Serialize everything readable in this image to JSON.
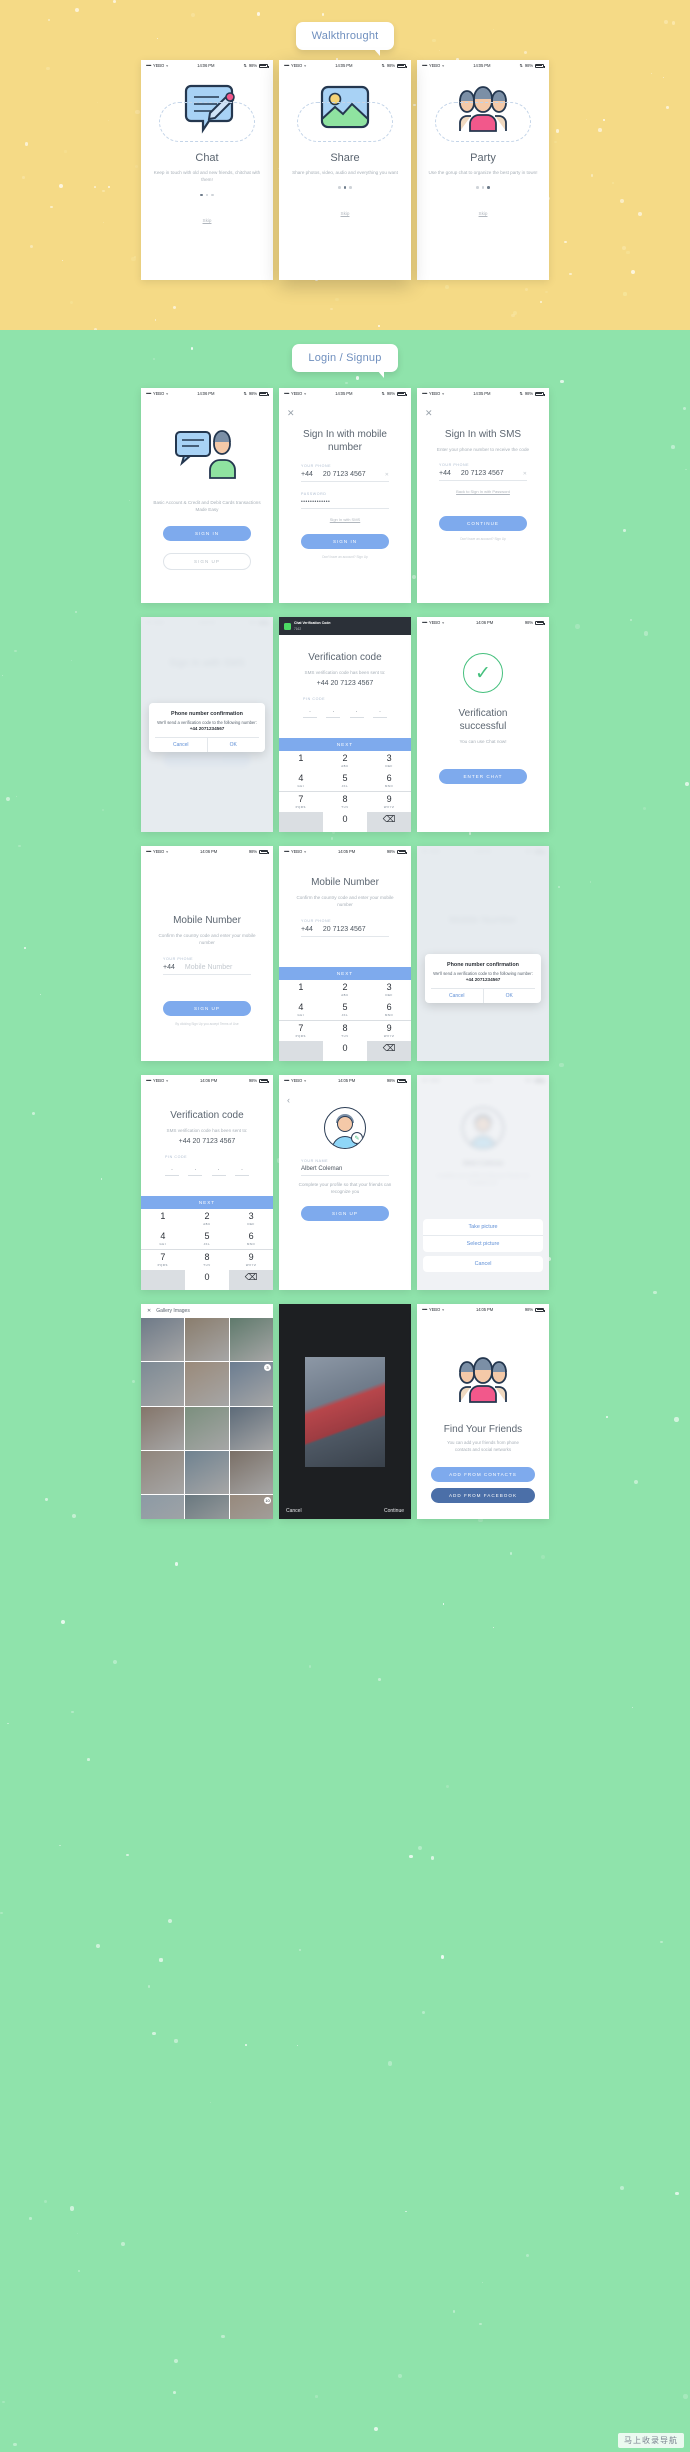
{
  "sections": [
    {
      "id": "walkthrough",
      "label": "Walkthrought",
      "bg": "#f5da86"
    },
    {
      "id": "login-signup",
      "label": "Login / Signup",
      "bg": "#8fe3ab"
    }
  ],
  "status_bar": {
    "carrier": "YEBO",
    "time_1405": "14:05 PM",
    "time_1406": "14:06 PM",
    "battery": "98%",
    "signal_dots": "•••••",
    "wifi_icon": "wifi-icon",
    "bluetooth_icon": "bluetooth-icon"
  },
  "walkthrough": {
    "slides": [
      {
        "title": "Chat",
        "desc": "Keep in touch with old and new friends, chitchat with them!",
        "skip": "Skip",
        "icon": "chat-bubble-pencil-icon",
        "active_dot": 0
      },
      {
        "title": "Share",
        "desc": "Share photos, video, audio and everything you want",
        "skip": "Skip",
        "icon": "landscape-photo-icon",
        "active_dot": 1
      },
      {
        "title": "Party",
        "desc": "Use the gorup chat to organize the best party in town!",
        "skip": "Skip",
        "icon": "group-people-icon",
        "active_dot": 2
      }
    ]
  },
  "login": {
    "welcome": {
      "caption": "Basic Account & Credit and Debit Cards transactions Made Easy",
      "sign_in": "SIGN IN",
      "sign_up": "SIGN UP",
      "icon": "chat-person-icon"
    },
    "signin_mobile": {
      "close": "✕",
      "title": "Sign In with mobile number",
      "phone_label": "YOUR PHONE",
      "country_code": "+44",
      "phone_number": "20 7123 4567",
      "clear_icon": "✕",
      "password_label": "PASSWORD",
      "password_value": "•••••••••••••",
      "link_sms": "Sign In with SMS",
      "button": "SIGN IN",
      "footer": "Don't have an account? Sign Up"
    },
    "signin_sms": {
      "close": "✕",
      "title": "Sign In with SMS",
      "subtitle": "Enter your phone number to receive the code",
      "phone_label": "YOUR PHONE",
      "country_code": "+44",
      "phone_number": "20 7123 4567",
      "clear_icon": "✕",
      "link_back": "Back to Sign In with Password",
      "button": "CONTINUE",
      "footer": "Don't have an account? Sign Up"
    },
    "sms_dialog": {
      "bg_title": "Sign In with SMS",
      "dialog_title": "Phone number confirmation",
      "dialog_body": "We'll send a verification code to the following number:",
      "dialog_number": "+44 2071234567",
      "cancel": "Cancel",
      "ok": "OK",
      "button": "CONTINUE"
    },
    "verification_code": {
      "notification": {
        "title": "Chat Verification Code:",
        "sub": "7162",
        "icon": "chat-app-icon"
      },
      "title": "Verification code",
      "subtitle": "SMS verification code has been sent to:",
      "number": "+44 20 7123 4567",
      "pin_label": "PIN CODE",
      "pin_digits": [
        "",
        "",
        "",
        ""
      ],
      "next": "NEXT"
    },
    "verification_success": {
      "check_icon": "check-circle-icon",
      "title": "Verification successful",
      "subtitle": "You can use Chat now!",
      "button": "ENTER CHAT"
    },
    "mobile_number_signup": {
      "title": "Mobile Number",
      "subtitle": "Confirm the country code and enter your mobile number",
      "phone_label": "YOUR PHONE",
      "country_code": "+44",
      "placeholder": "Mobile Number",
      "button": "SIGN UP",
      "footer": "By clicking Sign Up you accept Terms of Use"
    },
    "mobile_number_filled": {
      "title": "Mobile Number",
      "subtitle": "Confirm the country code and enter your mobile number",
      "phone_label": "YOUR PHONE",
      "country_code": "+44",
      "phone_number": "20 7123 4567",
      "next": "NEXT"
    },
    "mobile_number_dialog": {
      "bg_title": "Mobile Number",
      "dialog_title": "Phone number confirmation",
      "dialog_body": "We'll send a verification code to the following number:",
      "dialog_number": "+44 2071234567",
      "cancel": "Cancel",
      "ok": "OK",
      "button": "SIGN UP"
    },
    "verify_signup": {
      "title": "Verification code",
      "subtitle": "SMS verification code has been sent to:",
      "number": "+44 20 7123 4567",
      "pin_label": "PIN CODE",
      "next": "NEXT"
    },
    "profile": {
      "back": "‹",
      "avatar": "user-avatar-icon",
      "edit_badge": "camera-badge-icon",
      "name_label": "YOUR NAME",
      "name_value": "Albert Coleman",
      "hint": "Complete your profile so that your friends can recognize you",
      "button": "SIGN UP"
    },
    "profile_sheet": {
      "name_value": "Albert Coleman",
      "hint": "Complete your profile so that your friends can recognize you",
      "take_picture": "Take picture",
      "select_picture": "Select picture",
      "cancel": "Cancel"
    },
    "gallery": {
      "close": "✕",
      "title": "Gallery Images",
      "selected_badges": [
        "3",
        "10"
      ]
    },
    "photo_preview": {
      "cancel": "Cancel",
      "continue": "Continue"
    },
    "find_friends": {
      "icon": "group-people-icon",
      "title": "Find Your Friends",
      "subtitle": "You can add your friends from phone contacts and social networks",
      "btn_contacts": "ADD FROM CONTACTS",
      "btn_facebook": "ADD FROM FACEBOOK"
    }
  },
  "keypad": {
    "keys": [
      {
        "d": "1",
        "l": ""
      },
      {
        "d": "2",
        "l": "ABC"
      },
      {
        "d": "3",
        "l": "DEF"
      },
      {
        "d": "4",
        "l": "GHI"
      },
      {
        "d": "5",
        "l": "JKL"
      },
      {
        "d": "6",
        "l": "MNO"
      },
      {
        "d": "7",
        "l": "PQRS"
      },
      {
        "d": "8",
        "l": "TUV"
      },
      {
        "d": "9",
        "l": "WXYZ"
      },
      {
        "d": "",
        "l": ""
      },
      {
        "d": "0",
        "l": ""
      },
      {
        "d": "⌫",
        "l": ""
      }
    ]
  },
  "watermark": "马上收录导航",
  "colors": {
    "yellow_bg": "#f5da86",
    "green_bg": "#8fe3ab",
    "accent_blue": "#7eaaed",
    "dark_blue": "#4b6fa8",
    "success_green": "#45c07d",
    "text_dark": "#5b6570",
    "text_muted": "#a8b0b8"
  }
}
